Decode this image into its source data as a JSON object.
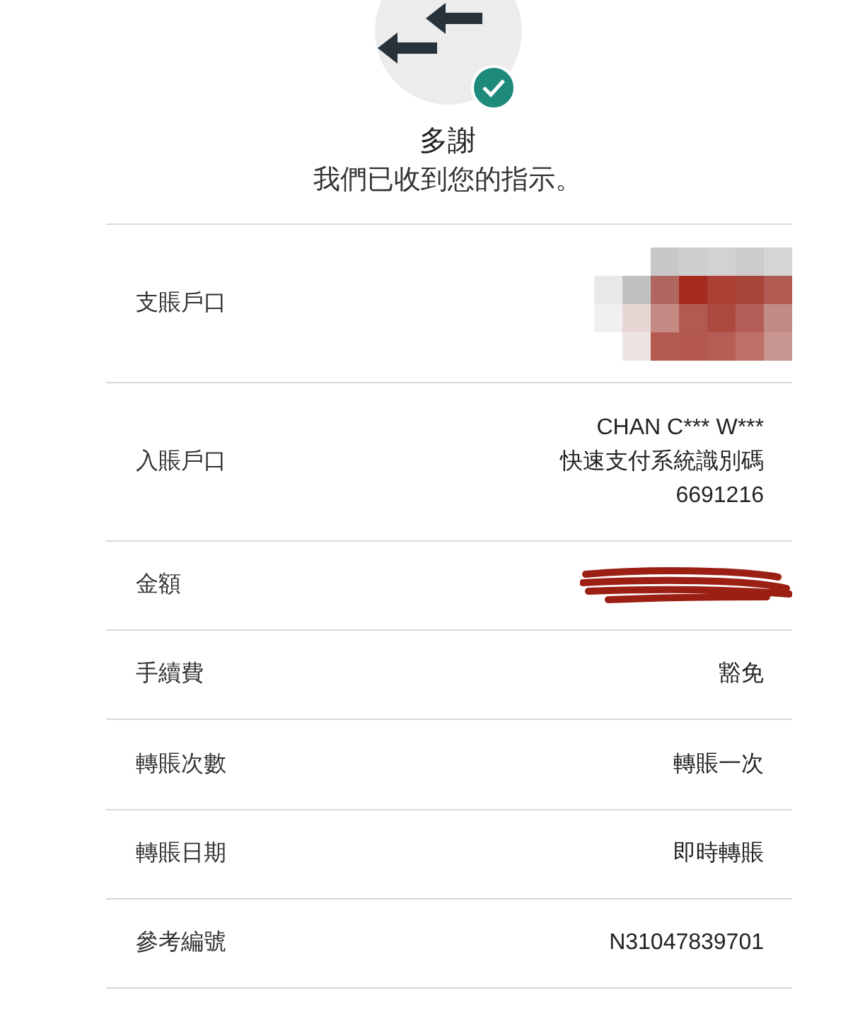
{
  "header": {
    "title": "多謝",
    "message": "我們已收到您的指示。"
  },
  "rows": [
    {
      "label": "支賬戶口",
      "kind": "mosaic"
    },
    {
      "label": "入賬戶口",
      "kind": "text",
      "lines": [
        "CHAN C*** W***",
        "快速支付系統識別碼",
        "6691216"
      ]
    },
    {
      "label": "金額",
      "kind": "scribble"
    },
    {
      "label": "手續費",
      "kind": "text",
      "lines": [
        "豁免"
      ]
    },
    {
      "label": "轉賬次數",
      "kind": "text",
      "lines": [
        "轉賬一次"
      ]
    },
    {
      "label": "轉賬日期",
      "kind": "text",
      "lines": [
        "即時轉賬"
      ]
    },
    {
      "label": "參考編號",
      "kind": "text",
      "lines": [
        "N31047839701"
      ]
    }
  ]
}
